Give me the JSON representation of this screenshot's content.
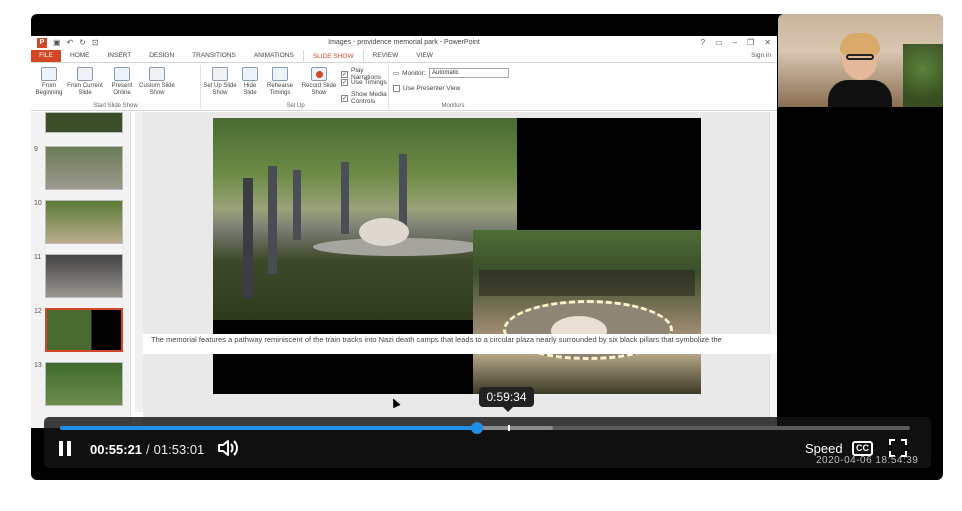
{
  "ppt": {
    "app_title": "Images - providence memorial park - PowerPoint",
    "tabs": [
      "FILE",
      "HOME",
      "INSERT",
      "DESIGN",
      "TRANSITIONS",
      "ANIMATIONS",
      "SLIDE SHOW",
      "REVIEW",
      "VIEW"
    ],
    "active_tab": "SLIDE SHOW",
    "sign_in": "Sign in",
    "ribbon": {
      "from_beginning": "From Beginning",
      "from_current": "From Current Slide",
      "present_online": "Present Online",
      "custom_slide_show": "Custom Slide Show",
      "start_group": "Start Slide Show",
      "setup_show": "Set Up Slide Show",
      "hide_slide": "Hide Slide",
      "rehearse": "Rehearse Timings",
      "record": "Record Slide Show",
      "setup_group": "Set Up",
      "play_narrations": "Play Narrations",
      "use_timings": "Use Timings",
      "show_media_controls": "Show Media Controls",
      "monitor_label": "Monitor:",
      "monitor_value": "Automatic",
      "use_presenter_view": "Use Presenter View",
      "monitors_group": "Monitors"
    },
    "slide_numbers": [
      "9",
      "10",
      "11",
      "12",
      "13"
    ],
    "selected_slide": "12",
    "notes_text": "The memorial features a pathway reminiscent of the train tracks into Nazi death camps that leads to a circular plaza nearly surrounded by six black pillars that symbolize the"
  },
  "player": {
    "hover_time": "0:59:34",
    "current_time": "00:55:21",
    "separator": "/",
    "duration": "01:53:01",
    "played_fraction": 0.49,
    "buffer_fraction": 0.58,
    "hover_fraction": 0.527,
    "speed_label": "Speed",
    "cc_label": "CC",
    "timestamp": "2020-04-06 18:54:39",
    "accent_color": "#1f8fe8"
  }
}
